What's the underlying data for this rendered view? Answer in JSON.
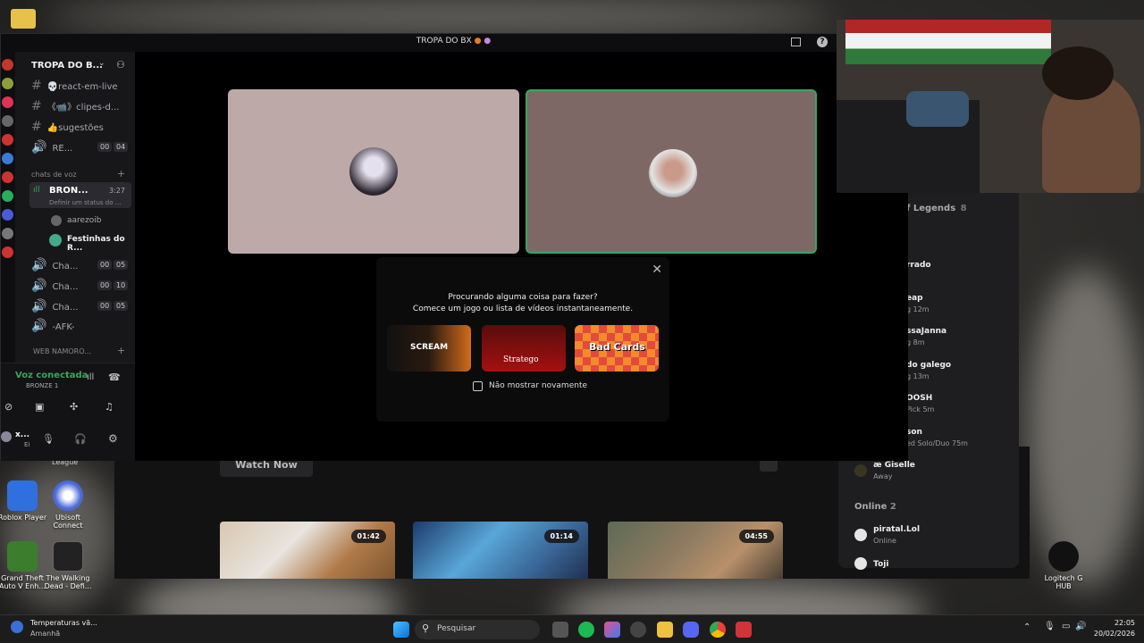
{
  "desktop": {
    "icons": [
      {
        "label": "Roblox Player"
      },
      {
        "label": "Ubisoft Connect"
      },
      {
        "label": "Grand Theft Auto V Enh..."
      },
      {
        "label": "The Walking Dead - Defi..."
      },
      {
        "label": "Logitech G HUB"
      }
    ],
    "league_label": "League"
  },
  "discord": {
    "window_title": "TROPA DO BX",
    "server_name": "TROPA DO B...",
    "channels": {
      "text": [
        "💀react-em-live",
        "《📹》clipes-d...",
        "👍sugestões"
      ],
      "voice_top": {
        "name": "RE...",
        "count_a": "00",
        "count_b": "04"
      },
      "voice_category": "chats de voz",
      "active_voice": {
        "name": "BRON...",
        "time": "3:27",
        "status_hint": "Definir um status do ..."
      },
      "members": [
        "aarezoib",
        "Festinhas do R..."
      ],
      "other_voice": [
        {
          "name": "Cha...",
          "a": "00",
          "b": "05"
        },
        {
          "name": "Cha...",
          "a": "00",
          "b": "10"
        },
        {
          "name": "Cha...",
          "a": "00",
          "b": "05"
        }
      ],
      "afk": "-AFK-",
      "category2": "WEB NAMORO..."
    },
    "voice_connected": {
      "status": "Voz conectada",
      "channel": "BRONZE 1"
    },
    "user": {
      "name": "x...",
      "sub": "Ei"
    },
    "popup": {
      "line1": "Procurando alguma coisa para fazer?",
      "line2": "Comece um jogo ou lista de vídeos instantaneamente.",
      "checkbox_label": "Não mostrar novamente",
      "games": [
        "SCREAM",
        "Stratego",
        "Bad Cards"
      ]
    }
  },
  "launcher": {
    "watch_now": "Watch Now",
    "videos": [
      "01:42",
      "01:14",
      "04:55"
    ]
  },
  "friends": {
    "header": "f Legends",
    "header_count": "8",
    "items": [
      {
        "name": "rrado",
        "sub": ""
      },
      {
        "name": "eap",
        "sub": "g 12m"
      },
      {
        "name": "ssaJanna",
        "sub": "g 8m"
      },
      {
        "name": "do galego",
        "sub": "g 13m"
      },
      {
        "name": "OOSH",
        "sub": "Pick 5m"
      },
      {
        "name": "son",
        "sub": "ed Solo/Duo 75m"
      },
      {
        "name": "æ Giselle",
        "sub": "Away"
      }
    ],
    "online_label": "Online",
    "online_count": "2",
    "online": [
      {
        "name": "piratal.Lol",
        "sub": "Online"
      },
      {
        "name": "Toji",
        "sub": ""
      }
    ]
  },
  "taskbar": {
    "weather_title": "Temperaturas vã...",
    "weather_sub": "Amanhã",
    "search": "Pesquisar",
    "time": "22:05",
    "date": "20/02/2026"
  }
}
